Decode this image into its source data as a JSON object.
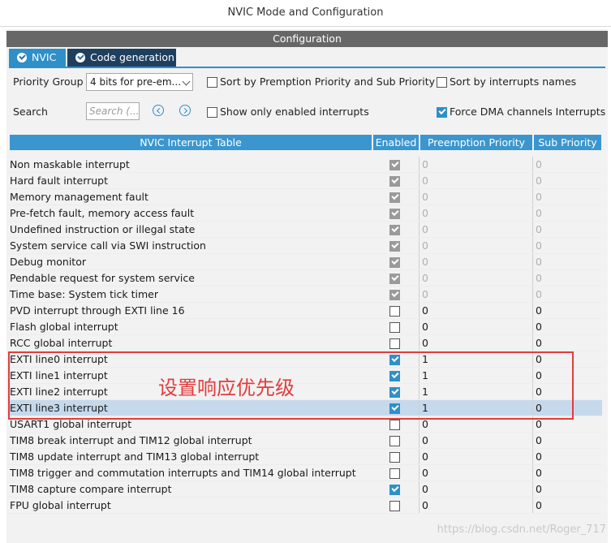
{
  "window": {
    "title": "NVIC Mode and Configuration"
  },
  "configuration": {
    "header": "Configuration"
  },
  "tabs": [
    {
      "label": "NVIC",
      "active": true
    },
    {
      "label": "Code generation",
      "active": false
    }
  ],
  "filters": {
    "priority_group_label": "Priority Group",
    "priority_group_value": "4 bits for pre-em...",
    "sort_by_premption_label": "Sort by Premption Priority and Sub Priority",
    "sort_by_premption_checked": false,
    "sort_by_names_label": "Sort by interrupts names",
    "sort_by_names_checked": false,
    "search_label": "Search",
    "search_placeholder": "Search (...",
    "show_only_enabled_label": "Show only enabled interrupts",
    "show_only_enabled_checked": false,
    "force_dma_label": "Force DMA channels Interrupts",
    "force_dma_checked": true
  },
  "table": {
    "columns": [
      "NVIC Interrupt Table",
      "Enabled",
      "Preemption Priority",
      "Sub Priority"
    ],
    "rows": [
      {
        "name": "Non maskable interrupt",
        "enabled": true,
        "locked": true,
        "preemption": "0",
        "sub": "0"
      },
      {
        "name": "Hard fault interrupt",
        "enabled": true,
        "locked": true,
        "preemption": "0",
        "sub": "0"
      },
      {
        "name": "Memory management fault",
        "enabled": true,
        "locked": true,
        "preemption": "0",
        "sub": "0"
      },
      {
        "name": "Pre-fetch fault, memory access fault",
        "enabled": true,
        "locked": true,
        "preemption": "0",
        "sub": "0"
      },
      {
        "name": "Undefined instruction or illegal state",
        "enabled": true,
        "locked": true,
        "preemption": "0",
        "sub": "0"
      },
      {
        "name": "System service call via SWI instruction",
        "enabled": true,
        "locked": true,
        "preemption": "0",
        "sub": "0"
      },
      {
        "name": "Debug monitor",
        "enabled": true,
        "locked": true,
        "preemption": "0",
        "sub": "0"
      },
      {
        "name": "Pendable request for system service",
        "enabled": true,
        "locked": true,
        "preemption": "0",
        "sub": "0"
      },
      {
        "name": "Time base: System tick timer",
        "enabled": true,
        "locked": true,
        "preemption": "0",
        "sub": "0"
      },
      {
        "name": "PVD interrupt through EXTI line 16",
        "enabled": false,
        "locked": false,
        "preemption": "0",
        "sub": "0"
      },
      {
        "name": "Flash global interrupt",
        "enabled": false,
        "locked": false,
        "preemption": "0",
        "sub": "0"
      },
      {
        "name": "RCC global interrupt",
        "enabled": false,
        "locked": false,
        "preemption": "0",
        "sub": "0"
      },
      {
        "name": "EXTI line0 interrupt",
        "enabled": true,
        "locked": false,
        "preemption": "1",
        "sub": "0"
      },
      {
        "name": "EXTI line1 interrupt",
        "enabled": true,
        "locked": false,
        "preemption": "1",
        "sub": "0"
      },
      {
        "name": "EXTI line2 interrupt",
        "enabled": true,
        "locked": false,
        "preemption": "1",
        "sub": "0"
      },
      {
        "name": "EXTI line3 interrupt",
        "enabled": true,
        "locked": false,
        "preemption": "1",
        "sub": "0",
        "selected": true
      },
      {
        "name": "USART1 global interrupt",
        "enabled": false,
        "locked": false,
        "preemption": "0",
        "sub": "0"
      },
      {
        "name": "TIM8 break interrupt and TIM12 global interrupt",
        "enabled": false,
        "locked": false,
        "preemption": "0",
        "sub": "0"
      },
      {
        "name": "TIM8 update interrupt and TIM13 global interrupt",
        "enabled": false,
        "locked": false,
        "preemption": "0",
        "sub": "0"
      },
      {
        "name": "TIM8 trigger and commutation interrupts and TIM14 global interrupt",
        "enabled": false,
        "locked": false,
        "preemption": "0",
        "sub": "0"
      },
      {
        "name": "TIM8 capture compare interrupt",
        "enabled": true,
        "locked": false,
        "preemption": "0",
        "sub": "0"
      },
      {
        "name": "FPU global interrupt",
        "enabled": false,
        "locked": false,
        "preemption": "0",
        "sub": "0"
      }
    ]
  },
  "annotation": {
    "text": "设置响应优先级",
    "color": "#e23c3c"
  },
  "watermark": "https://blog.csdn.net/Roger_717",
  "colors": {
    "accent": "#2f8fc8",
    "header_bg": "#676767",
    "selected_row": "#c6d9ec",
    "annotation": "#e23c3c"
  }
}
